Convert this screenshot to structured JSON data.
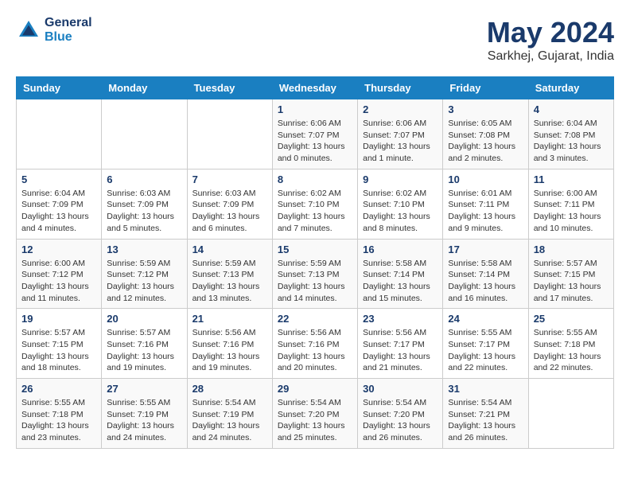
{
  "header": {
    "logo_line1": "General",
    "logo_line2": "Blue",
    "month": "May 2024",
    "location": "Sarkhej, Gujarat, India"
  },
  "days_of_week": [
    "Sunday",
    "Monday",
    "Tuesday",
    "Wednesday",
    "Thursday",
    "Friday",
    "Saturday"
  ],
  "weeks": [
    [
      {
        "day": "",
        "info": ""
      },
      {
        "day": "",
        "info": ""
      },
      {
        "day": "",
        "info": ""
      },
      {
        "day": "1",
        "info": "Sunrise: 6:06 AM\nSunset: 7:07 PM\nDaylight: 13 hours\nand 0 minutes."
      },
      {
        "day": "2",
        "info": "Sunrise: 6:06 AM\nSunset: 7:07 PM\nDaylight: 13 hours\nand 1 minute."
      },
      {
        "day": "3",
        "info": "Sunrise: 6:05 AM\nSunset: 7:08 PM\nDaylight: 13 hours\nand 2 minutes."
      },
      {
        "day": "4",
        "info": "Sunrise: 6:04 AM\nSunset: 7:08 PM\nDaylight: 13 hours\nand 3 minutes."
      }
    ],
    [
      {
        "day": "5",
        "info": "Sunrise: 6:04 AM\nSunset: 7:09 PM\nDaylight: 13 hours\nand 4 minutes."
      },
      {
        "day": "6",
        "info": "Sunrise: 6:03 AM\nSunset: 7:09 PM\nDaylight: 13 hours\nand 5 minutes."
      },
      {
        "day": "7",
        "info": "Sunrise: 6:03 AM\nSunset: 7:09 PM\nDaylight: 13 hours\nand 6 minutes."
      },
      {
        "day": "8",
        "info": "Sunrise: 6:02 AM\nSunset: 7:10 PM\nDaylight: 13 hours\nand 7 minutes."
      },
      {
        "day": "9",
        "info": "Sunrise: 6:02 AM\nSunset: 7:10 PM\nDaylight: 13 hours\nand 8 minutes."
      },
      {
        "day": "10",
        "info": "Sunrise: 6:01 AM\nSunset: 7:11 PM\nDaylight: 13 hours\nand 9 minutes."
      },
      {
        "day": "11",
        "info": "Sunrise: 6:00 AM\nSunset: 7:11 PM\nDaylight: 13 hours\nand 10 minutes."
      }
    ],
    [
      {
        "day": "12",
        "info": "Sunrise: 6:00 AM\nSunset: 7:12 PM\nDaylight: 13 hours\nand 11 minutes."
      },
      {
        "day": "13",
        "info": "Sunrise: 5:59 AM\nSunset: 7:12 PM\nDaylight: 13 hours\nand 12 minutes."
      },
      {
        "day": "14",
        "info": "Sunrise: 5:59 AM\nSunset: 7:13 PM\nDaylight: 13 hours\nand 13 minutes."
      },
      {
        "day": "15",
        "info": "Sunrise: 5:59 AM\nSunset: 7:13 PM\nDaylight: 13 hours\nand 14 minutes."
      },
      {
        "day": "16",
        "info": "Sunrise: 5:58 AM\nSunset: 7:14 PM\nDaylight: 13 hours\nand 15 minutes."
      },
      {
        "day": "17",
        "info": "Sunrise: 5:58 AM\nSunset: 7:14 PM\nDaylight: 13 hours\nand 16 minutes."
      },
      {
        "day": "18",
        "info": "Sunrise: 5:57 AM\nSunset: 7:15 PM\nDaylight: 13 hours\nand 17 minutes."
      }
    ],
    [
      {
        "day": "19",
        "info": "Sunrise: 5:57 AM\nSunset: 7:15 PM\nDaylight: 13 hours\nand 18 minutes."
      },
      {
        "day": "20",
        "info": "Sunrise: 5:57 AM\nSunset: 7:16 PM\nDaylight: 13 hours\nand 19 minutes."
      },
      {
        "day": "21",
        "info": "Sunrise: 5:56 AM\nSunset: 7:16 PM\nDaylight: 13 hours\nand 19 minutes."
      },
      {
        "day": "22",
        "info": "Sunrise: 5:56 AM\nSunset: 7:16 PM\nDaylight: 13 hours\nand 20 minutes."
      },
      {
        "day": "23",
        "info": "Sunrise: 5:56 AM\nSunset: 7:17 PM\nDaylight: 13 hours\nand 21 minutes."
      },
      {
        "day": "24",
        "info": "Sunrise: 5:55 AM\nSunset: 7:17 PM\nDaylight: 13 hours\nand 22 minutes."
      },
      {
        "day": "25",
        "info": "Sunrise: 5:55 AM\nSunset: 7:18 PM\nDaylight: 13 hours\nand 22 minutes."
      }
    ],
    [
      {
        "day": "26",
        "info": "Sunrise: 5:55 AM\nSunset: 7:18 PM\nDaylight: 13 hours\nand 23 minutes."
      },
      {
        "day": "27",
        "info": "Sunrise: 5:55 AM\nSunset: 7:19 PM\nDaylight: 13 hours\nand 24 minutes."
      },
      {
        "day": "28",
        "info": "Sunrise: 5:54 AM\nSunset: 7:19 PM\nDaylight: 13 hours\nand 24 minutes."
      },
      {
        "day": "29",
        "info": "Sunrise: 5:54 AM\nSunset: 7:20 PM\nDaylight: 13 hours\nand 25 minutes."
      },
      {
        "day": "30",
        "info": "Sunrise: 5:54 AM\nSunset: 7:20 PM\nDaylight: 13 hours\nand 26 minutes."
      },
      {
        "day": "31",
        "info": "Sunrise: 5:54 AM\nSunset: 7:21 PM\nDaylight: 13 hours\nand 26 minutes."
      },
      {
        "day": "",
        "info": ""
      }
    ]
  ]
}
